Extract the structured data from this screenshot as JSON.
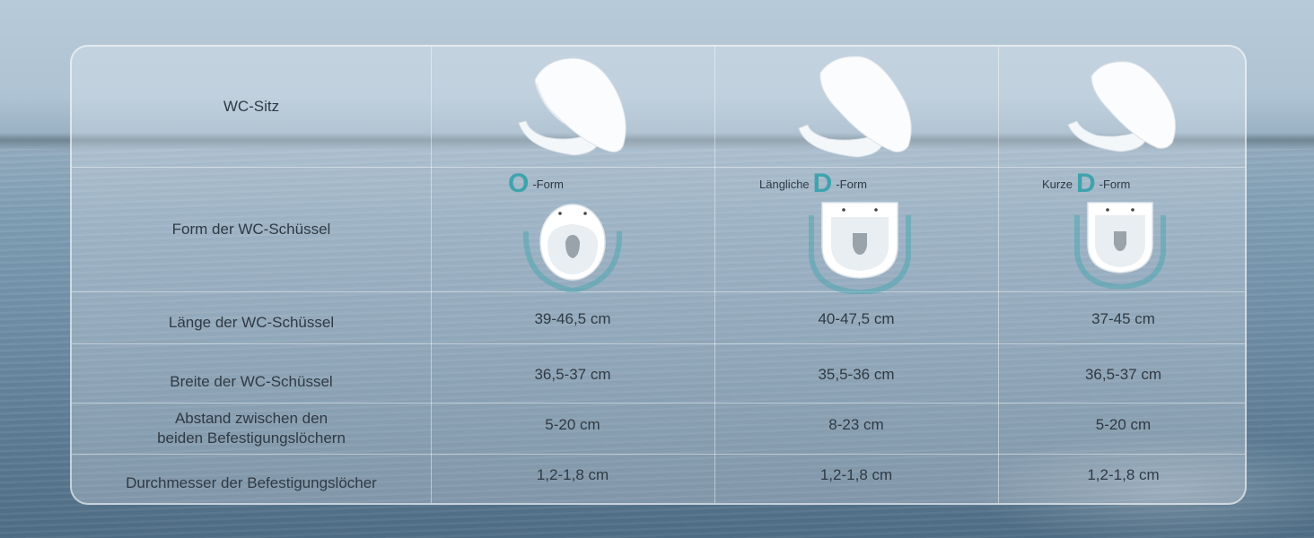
{
  "row_labels": {
    "seat": "WC-Sitz",
    "bowl_shape": "Form der WC-Schüssel",
    "length": "Länge der WC-Schüssel",
    "width": "Breite der WC-Schüssel",
    "hole_distance_line1": "Abstand zwischen den",
    "hole_distance_line2": "beiden Befestigungslöchern",
    "hole_diameter": "Durchmesser der Befestigungslöcher"
  },
  "columns": [
    {
      "shape_prefix": "",
      "shape_letter": "O",
      "shape_suffix": "-Form",
      "length": "39-46,5 cm",
      "width": "36,5-37 cm",
      "hole_distance": "5-20 cm",
      "hole_diameter": "1,2-1,8 cm",
      "seat_icon": "o-shaped-toilet-seat-icon",
      "bowl_icon": "o-shaped-bowl-icon"
    },
    {
      "shape_prefix": "Längliche",
      "shape_letter": "D",
      "shape_suffix": "-Form",
      "length": "40-47,5 cm",
      "width": "35,5-36 cm",
      "hole_distance": "8-23 cm",
      "hole_diameter": "1,2-1,8 cm",
      "seat_icon": "long-d-shaped-toilet-seat-icon",
      "bowl_icon": "long-d-shaped-bowl-icon"
    },
    {
      "shape_prefix": "Kurze",
      "shape_letter": "D",
      "shape_suffix": "-Form",
      "length": "37-45 cm",
      "width": "36,5-37 cm",
      "hole_distance": "5-20 cm",
      "hole_diameter": "1,2-1,8 cm",
      "seat_icon": "short-d-shaped-toilet-seat-icon",
      "bowl_icon": "short-d-shaped-bowl-icon"
    }
  ],
  "colors": {
    "accent": "#3fa3ad",
    "text": "#2f3a44"
  }
}
